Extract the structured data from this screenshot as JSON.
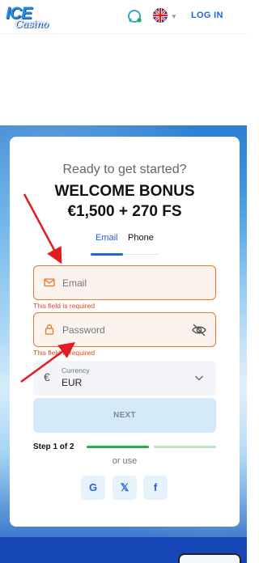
{
  "header": {
    "logo_main": "ICE",
    "logo_sub": "Casino",
    "login_label": "LOG IN"
  },
  "card": {
    "tagline": "Ready to get started?",
    "bonus_title": "WELCOME BONUS",
    "bonus_amount": "€1,500 + 270 FS",
    "tabs": [
      {
        "label": "Email",
        "active": true
      },
      {
        "label": "Phone",
        "active": false
      }
    ],
    "email": {
      "placeholder": "Email",
      "value": "",
      "error": "This field is required"
    },
    "password": {
      "placeholder": "Password",
      "value": "",
      "error": "This field is required"
    },
    "currency": {
      "label": "Currency",
      "value": "EUR",
      "symbol": "€"
    },
    "next_label": "NEXT",
    "step_label": "Step 1 of 2",
    "or_use": "or use",
    "social": [
      {
        "icon": "google-icon",
        "glyph": "G"
      },
      {
        "icon": "x-twitter-icon",
        "glyph": "𝕏"
      },
      {
        "icon": "facebook-icon",
        "glyph": "f"
      }
    ]
  },
  "colors": {
    "accent": "#1f63d6",
    "error": "#e9762a",
    "step_active": "#1fb24f",
    "step_inactive": "#b9e6c7",
    "next_bg": "#d4eaf9",
    "annotation": "#e11d1d"
  }
}
